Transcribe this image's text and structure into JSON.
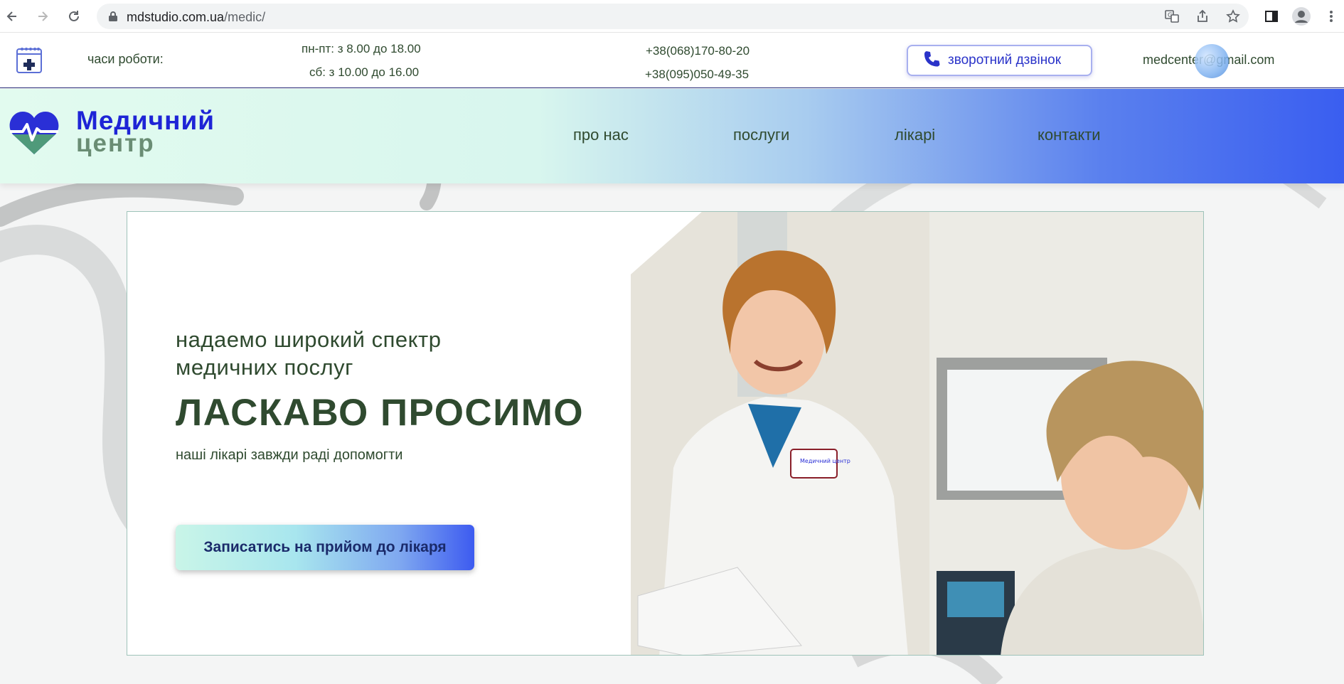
{
  "browser": {
    "url_host": "mdstudio.com.ua",
    "url_path": "/medic/"
  },
  "infobar": {
    "hours_label": "часи роботи:",
    "hours_weekdays": "пн-пт: з 8.00 до 18.00",
    "hours_saturday": "сб: з 10.00 до 16.00",
    "phone1": "+38(068)170-80-20",
    "phone2": "+38(095)050-49-35",
    "callback_label": "зворотний дзвінок",
    "email": "medcenter@gmail.com"
  },
  "header": {
    "logo_line1": "Медичний",
    "logo_line2": "центр",
    "nav": [
      "про нас",
      "послуги",
      "лікарі",
      "контакти"
    ]
  },
  "hero": {
    "subtitle": "надаемо широкий спектр медичних послуг",
    "title": "ЛАСКАВО ПРОСИМО",
    "tagline": "наші лікарі завжди раді допомогти",
    "cta_label": "Записатись на прийом до лікаря",
    "badge_text": "Медичний центр"
  },
  "colors": {
    "brand_blue": "#1e24d6",
    "brand_green": "#6a8d74",
    "text_dark_green": "#2f4a2f"
  }
}
